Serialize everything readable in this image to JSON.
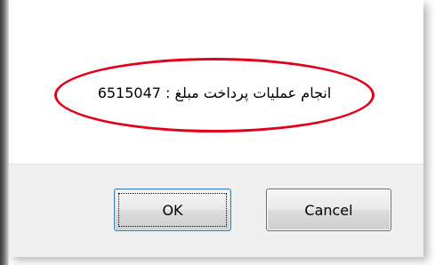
{
  "dialog": {
    "message": "انجام عملیات پرداخت مبلغ : 6515047"
  },
  "buttons": {
    "ok_label": "OK",
    "cancel_label": "Cancel"
  },
  "colors": {
    "highlight": "#e3001b",
    "button_area": "#f0f0f0",
    "default_button_border": "#3c7fb1"
  }
}
